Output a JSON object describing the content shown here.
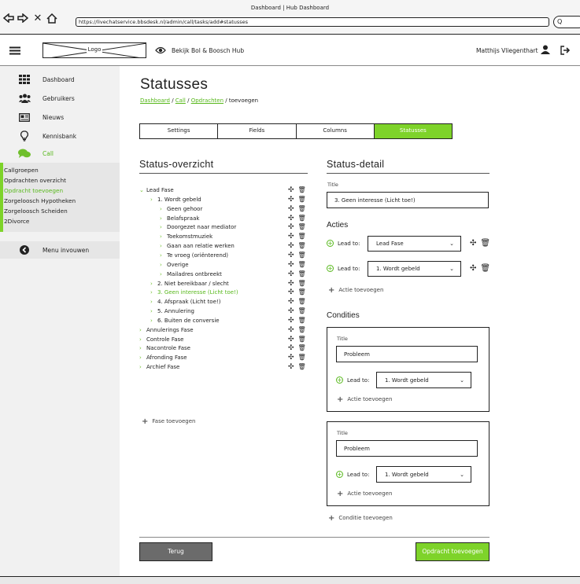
{
  "browser": {
    "title": "Dashboard | Hub Dashboard",
    "url": "https://livechatservice.bbsdesk.nl/admin/call/tasks/add#statusses",
    "search_placeholder": "Q"
  },
  "topbar": {
    "logo": "Logo",
    "hub_link": "Bekijk Bol & Boosch Hub",
    "user": "Matthijs Vliegenthart"
  },
  "sidebar": {
    "items": [
      {
        "label": "Dashboard",
        "icon": "grid-icon"
      },
      {
        "label": "Gebruikers",
        "icon": "users-icon"
      },
      {
        "label": "Nieuws",
        "icon": "newspaper-icon"
      },
      {
        "label": "Kennisbank",
        "icon": "lightbulb-icon"
      },
      {
        "label": "Call",
        "icon": "chat-icon"
      }
    ],
    "sub_items": [
      {
        "label": "Callgroepen",
        "active": false
      },
      {
        "label": "Opdrachten overzicht",
        "active": false
      },
      {
        "label": "Opdracht toevoegen",
        "active": true
      },
      {
        "label": "Zorgeloosch Hypotheken",
        "active": false
      },
      {
        "label": "Zorgeloosch Scheiden",
        "active": false
      },
      {
        "label": "2Divorce",
        "active": false
      }
    ],
    "collapse": "Menu invouwen"
  },
  "page": {
    "title": "Statusses",
    "breadcrumb": {
      "dashboard": "Dashboard",
      "sep1": " / ",
      "call": "Call",
      "sep2": " / ",
      "opdrachten": "Opdrachten",
      "sep3": " / ",
      "current": "toevoegen"
    }
  },
  "tabs": [
    "Settings",
    "Fields",
    "Columns",
    "Statusses"
  ],
  "overview": {
    "heading": "Status-overzicht",
    "tree": [
      {
        "label": "Lead Fase",
        "level": 0,
        "chev": "⌄",
        "active": false
      },
      {
        "label": "1. Wordt gebeld",
        "level": 1,
        "chev": "›",
        "active": false
      },
      {
        "label": "Geen gehoor",
        "level": 2,
        "chev": "›",
        "active": false
      },
      {
        "label": "Belafspraak",
        "level": 2,
        "chev": "›",
        "active": false
      },
      {
        "label": "Doorgezet naar mediator",
        "level": 2,
        "chev": "›",
        "active": false
      },
      {
        "label": "Toekomstmuziek",
        "level": 2,
        "chev": "›",
        "active": false
      },
      {
        "label": "Gaan aan relatie werken",
        "level": 2,
        "chev": "›",
        "active": false
      },
      {
        "label": "Te vroeg (oriënterend)",
        "level": 2,
        "chev": "›",
        "active": false
      },
      {
        "label": "Overige",
        "level": 2,
        "chev": "›",
        "active": false
      },
      {
        "label": "Mailadres ontbreekt",
        "level": 2,
        "chev": "›",
        "active": false
      },
      {
        "label": "2. Niet bereikbaar / slecht",
        "level": 1,
        "chev": "›",
        "active": false
      },
      {
        "label": "3. Geen interesse (Licht toe!)",
        "level": 1,
        "chev": "›",
        "active": true
      },
      {
        "label": "4. Afspraak (Licht toe!)",
        "level": 1,
        "chev": "›",
        "active": false
      },
      {
        "label": "5. Annulering",
        "level": 1,
        "chev": "›",
        "active": false
      },
      {
        "label": "6. Buiten de conversie",
        "level": 1,
        "chev": "›",
        "active": false
      },
      {
        "label": "Annulerings Fase",
        "level": 0,
        "chev": "›",
        "active": false
      },
      {
        "label": "Controle Fase",
        "level": 0,
        "chev": "›",
        "active": false
      },
      {
        "label": "Nacontrole Fase",
        "level": 0,
        "chev": "›",
        "active": false
      },
      {
        "label": "Afronding Fase",
        "level": 0,
        "chev": "›",
        "active": false
      },
      {
        "label": "Archief Fase",
        "level": 0,
        "chev": "›",
        "active": false
      }
    ],
    "add_phase": "Fase toevoegen"
  },
  "detail": {
    "heading": "Status-detail",
    "title_label": "Title",
    "title_value": "3. Geen interesse (Licht toe!)",
    "acties_heading": "Acties",
    "acties": [
      {
        "lead_label": "Lead to:",
        "value": "Lead Fase"
      },
      {
        "lead_label": "Lead to:",
        "value": "1. Wordt gebeld"
      }
    ],
    "add_action": "Actie toevoegen",
    "condities_heading": "Condities",
    "condities": [
      {
        "title_label": "Title",
        "title_value": "Probleem",
        "lead_label": "Lead to:",
        "lead_value": "1. Wordt gebeld",
        "add_action": "Actie toevoegen"
      },
      {
        "title_label": "Title",
        "title_value": "Probleem",
        "lead_label": "Lead to:",
        "lead_value": "1. Wordt gebeld",
        "add_action": "Actie toevoegen"
      }
    ],
    "add_condition": "Conditie toevoegen"
  },
  "footer": {
    "back": "Terug",
    "submit": "Opdracht toevoegen"
  },
  "colors": {
    "accent": "#7ed32a",
    "accent_text": "#58b81c",
    "dark_button": "#6b6b6b"
  }
}
